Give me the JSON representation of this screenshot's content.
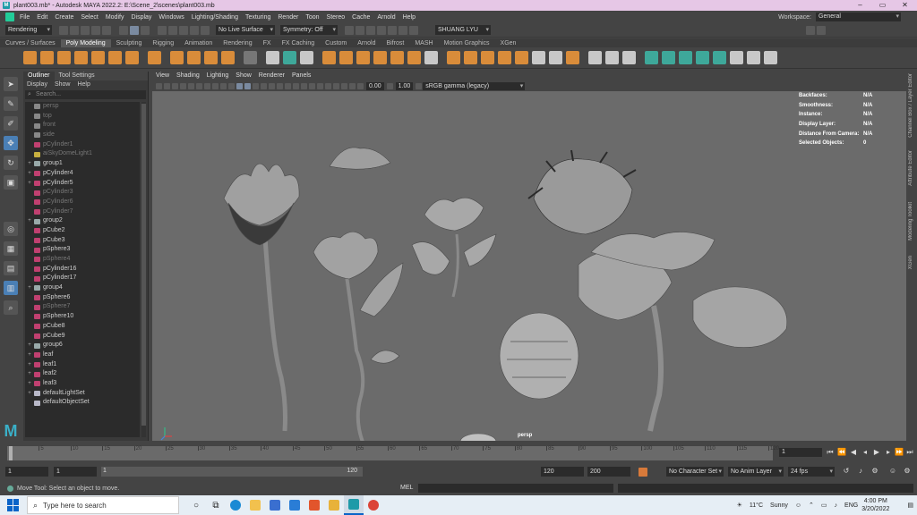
{
  "window": {
    "title": "plant003.mb* - Autodesk MAYA 2022.2: E:\\Scene_2\\scenes\\plant003.mb"
  },
  "menubar": {
    "items": [
      "File",
      "Edit",
      "Create",
      "Select",
      "Modify",
      "Display",
      "Windows",
      "Lighting/Shading",
      "Texturing",
      "Render",
      "Toon",
      "Stereo",
      "Cache",
      "Arnold",
      "Help"
    ],
    "workspace_label": "Workspace:",
    "workspace_value": "General"
  },
  "statusline": {
    "menuset": "Rendering",
    "live_surface": "No Live Surface",
    "symmetry": "Symmetry: Off",
    "user": "SHUANG LYU"
  },
  "shelf_tabs": {
    "items": [
      "Curves / Surfaces",
      "Poly Modeling",
      "Sculpting",
      "Rigging",
      "Animation",
      "Rendering",
      "FX",
      "FX Caching",
      "Custom",
      "Arnold",
      "Bifrost",
      "MASH",
      "Motion Graphics",
      "XGen"
    ],
    "active": "Poly Modeling"
  },
  "outliner": {
    "tabs": [
      "Outliner",
      "Tool Settings"
    ],
    "menu": [
      "Display",
      "Show",
      "Help"
    ],
    "search_placeholder": "Search...",
    "items": [
      {
        "label": "persp",
        "expand": "",
        "dim": true,
        "icon": "camera"
      },
      {
        "label": "top",
        "expand": "",
        "dim": true,
        "icon": "camera"
      },
      {
        "label": "front",
        "expand": "",
        "dim": true,
        "icon": "camera"
      },
      {
        "label": "side",
        "expand": "",
        "dim": true,
        "icon": "camera"
      },
      {
        "label": "pCylinder1",
        "expand": "",
        "dim": true,
        "icon": "mesh"
      },
      {
        "label": "aiSkyDomeLight1",
        "expand": "",
        "dim": true,
        "icon": "light"
      },
      {
        "label": "group1",
        "expand": "+",
        "dim": false,
        "icon": "group"
      },
      {
        "label": "pCylinder4",
        "expand": "+",
        "dim": false,
        "icon": "mesh"
      },
      {
        "label": "pCylinder5",
        "expand": "+",
        "dim": false,
        "icon": "mesh"
      },
      {
        "label": "pCylinder3",
        "expand": "",
        "dim": true,
        "icon": "mesh"
      },
      {
        "label": "pCylinder6",
        "expand": "",
        "dim": true,
        "icon": "mesh"
      },
      {
        "label": "pCylinder7",
        "expand": "",
        "dim": true,
        "icon": "mesh"
      },
      {
        "label": "group2",
        "expand": "+",
        "dim": false,
        "icon": "group"
      },
      {
        "label": "pCube2",
        "expand": "",
        "dim": false,
        "icon": "mesh"
      },
      {
        "label": "pCube3",
        "expand": "",
        "dim": false,
        "icon": "mesh"
      },
      {
        "label": "pSphere3",
        "expand": "",
        "dim": false,
        "icon": "mesh"
      },
      {
        "label": "pSphere4",
        "expand": "",
        "dim": true,
        "icon": "mesh"
      },
      {
        "label": "pCylinder16",
        "expand": "",
        "dim": false,
        "icon": "mesh"
      },
      {
        "label": "pCylinder17",
        "expand": "",
        "dim": false,
        "icon": "mesh"
      },
      {
        "label": "group4",
        "expand": "+",
        "dim": false,
        "icon": "group"
      },
      {
        "label": "pSphere6",
        "expand": "",
        "dim": false,
        "icon": "mesh"
      },
      {
        "label": "pSphere7",
        "expand": "",
        "dim": true,
        "icon": "mesh"
      },
      {
        "label": "pSphere10",
        "expand": "",
        "dim": false,
        "icon": "mesh"
      },
      {
        "label": "pCube8",
        "expand": "",
        "dim": false,
        "icon": "mesh"
      },
      {
        "label": "pCube9",
        "expand": "",
        "dim": false,
        "icon": "mesh"
      },
      {
        "label": "group6",
        "expand": "+",
        "dim": false,
        "icon": "group"
      },
      {
        "label": "leaf",
        "expand": "+",
        "dim": false,
        "icon": "mesh"
      },
      {
        "label": "leaf1",
        "expand": "+",
        "dim": false,
        "icon": "mesh"
      },
      {
        "label": "leaf2",
        "expand": "+",
        "dim": false,
        "icon": "mesh"
      },
      {
        "label": "leaf3",
        "expand": "+",
        "dim": false,
        "icon": "mesh"
      },
      {
        "label": "defaultLightSet",
        "expand": "+",
        "dim": false,
        "icon": "set"
      },
      {
        "label": "defaultObjectSet",
        "expand": "",
        "dim": false,
        "icon": "set"
      }
    ]
  },
  "viewport": {
    "menu": [
      "View",
      "Shading",
      "Lighting",
      "Show",
      "Renderer",
      "Panels"
    ],
    "exposure": "0.00",
    "gamma": "1.00",
    "colorspace": "sRGB gamma (legacy)",
    "camera": "persp",
    "hud": [
      {
        "label": "Backfaces:",
        "value": "N/A"
      },
      {
        "label": "Smoothness:",
        "value": "N/A"
      },
      {
        "label": "Instance:",
        "value": "N/A"
      },
      {
        "label": "Display Layer:",
        "value": "N/A"
      },
      {
        "label": "Distance From Camera:",
        "value": "N/A"
      },
      {
        "label": "Selected Objects:",
        "value": "0"
      }
    ]
  },
  "side_panels": [
    "Channel Box / Layer Editor",
    "Attribute Editor",
    "Modeling Toolkit",
    "XGen"
  ],
  "timeslider": {
    "ticks": [
      "5",
      "10",
      "15",
      "20",
      "25",
      "30",
      "35",
      "40",
      "45",
      "50",
      "55",
      "60",
      "65",
      "70",
      "75",
      "80",
      "85",
      "90",
      "95",
      "100",
      "105",
      "110",
      "115",
      "120"
    ],
    "current_frame": "1"
  },
  "range": {
    "start": "1",
    "anim_start": "1",
    "slider_start": "1",
    "slider_end": "120",
    "anim_end": "120",
    "end": "200",
    "character_set": "No Character Set",
    "anim_layer": "No Anim Layer",
    "fps": "24 fps"
  },
  "helpline": {
    "text": "Move Tool: Select an object to move.",
    "mel_label": "MEL"
  },
  "taskbar": {
    "search": "Type here to search",
    "weather_temp": "11°C",
    "weather_desc": "Sunny",
    "lang": "ENG",
    "time": "4:00 PM",
    "date": "3/20/2022"
  }
}
